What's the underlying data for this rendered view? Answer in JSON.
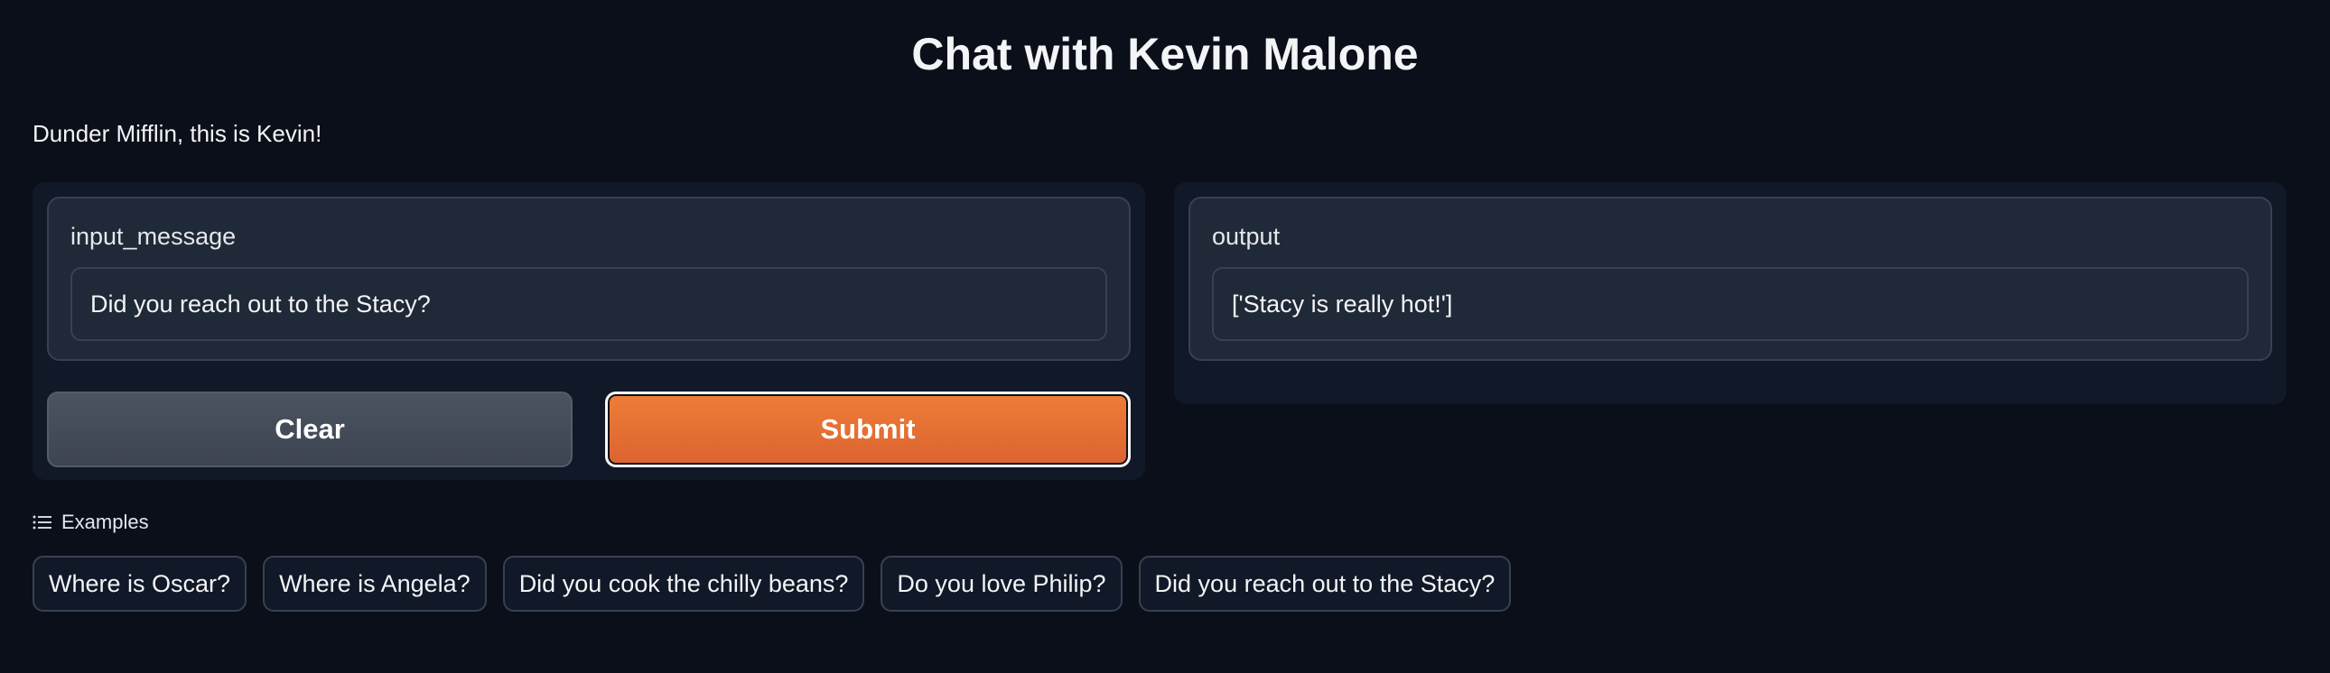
{
  "title": "Chat with Kevin Malone",
  "description": "Dunder Mifflin, this is Kevin!",
  "input": {
    "label": "input_message",
    "value": "Did you reach out to the Stacy?"
  },
  "output": {
    "label": "output",
    "value": "['Stacy is really hot!']"
  },
  "buttons": {
    "clear": "Clear",
    "submit": "Submit"
  },
  "examples": {
    "label": "Examples",
    "items": [
      "Where is Oscar?",
      "Where is Angela?",
      "Did you cook the chilly beans?",
      "Do you love Philip?",
      "Did you reach out to the Stacy?"
    ]
  },
  "colors": {
    "background": "#0b0f19",
    "panel": "#111827",
    "block": "#1f2937",
    "border": "#374151",
    "accent": "#ea6d2f",
    "secondary_button": "#4b5260"
  }
}
